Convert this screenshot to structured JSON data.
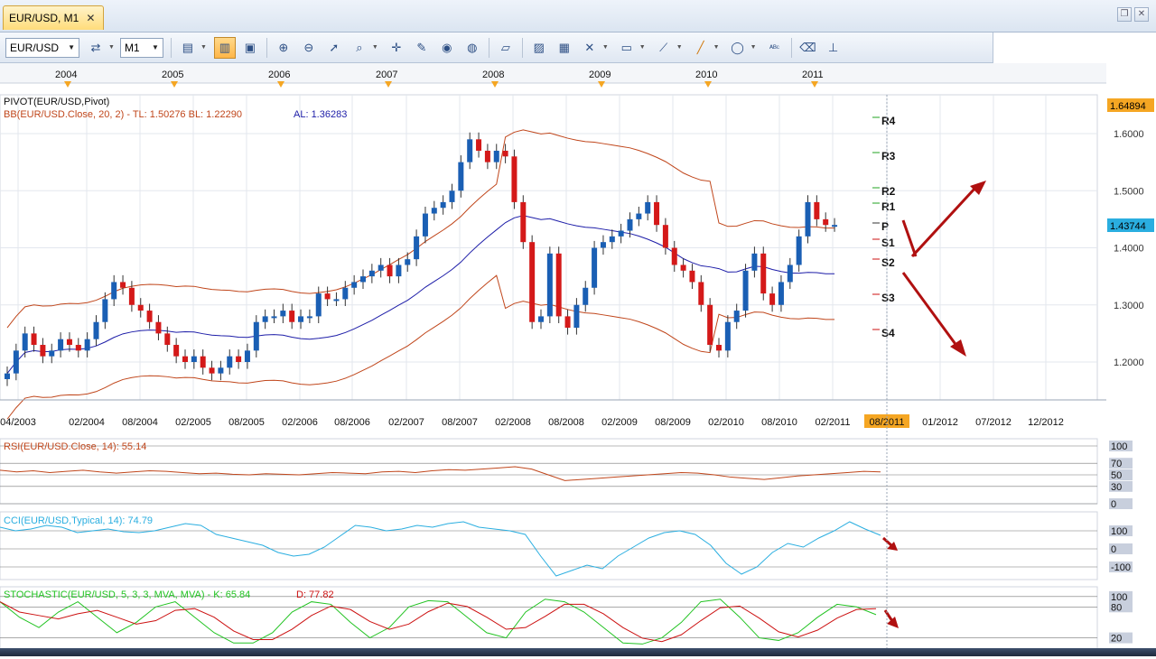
{
  "tab": {
    "title": "EUR/USD, M1",
    "close": "✕"
  },
  "window_buttons": [
    "❐",
    "✕"
  ],
  "toolbar": {
    "symbol": "EUR/USD",
    "timeframe": "M1",
    "icons": [
      "order-icon",
      "chart-type-icon",
      "candles-icon",
      "ohlc-icon",
      "zoom-in-icon",
      "zoom-out-icon",
      "cursor-icon",
      "magnifier-icon",
      "crosshair-icon",
      "pencil-icon",
      "eye-icon",
      "globe-icon",
      "ruler-icon",
      "image-icon",
      "template-icon",
      "tools-icon",
      "indicator-icon",
      "trendline-icon",
      "line-color-icon",
      "ellipse-icon",
      "text-icon",
      "eraser-icon",
      "hierarchy-icon"
    ]
  },
  "main": {
    "year_labels": [
      "2004",
      "2005",
      "2006",
      "2007",
      "2008",
      "2009",
      "2010",
      "2011"
    ],
    "legend": {
      "pivot": "PIVOT(EUR/USD,Pivot)",
      "bb": "BB(EUR/USD.Close, 20, 2) -  TL: 1.50276  BL: 1.22290",
      "al": "AL: 1.36283"
    },
    "y_ticks": [
      "1.6000",
      "1.5000",
      "1.4000",
      "1.3000",
      "1.2000"
    ],
    "price_top": "1.64894",
    "price_last": "1.43744",
    "pivot_labels": [
      "R4",
      "R3",
      "R2",
      "R1",
      "P",
      "S1",
      "S2",
      "S3",
      "S4"
    ],
    "x_ticks": [
      "04/2003",
      "02/2004",
      "08/2004",
      "02/2005",
      "08/2005",
      "02/2006",
      "08/2006",
      "02/2007",
      "08/2007",
      "02/2008",
      "08/2008",
      "02/2009",
      "08/2009",
      "02/2010",
      "08/2010",
      "02/2011",
      "08/2011",
      "01/2012",
      "07/2012",
      "12/2012"
    ],
    "x_highlight": "08/2011"
  },
  "rsi": {
    "legend": "RSI(EUR/USD.Close, 14): 55.14",
    "ticks": [
      "100",
      "70",
      "50",
      "30",
      "0"
    ]
  },
  "cci": {
    "legend": "CCI(EUR/USD,Typical, 14): 74.79",
    "ticks": [
      "100",
      "0",
      "-100"
    ]
  },
  "stoch": {
    "legend_main": "STOCHASTIC(EUR/USD, 5, 3, 3, MVA, MVA) -  K: 65.84",
    "legend_d": "D: 77.82",
    "ticks": [
      "100",
      "80",
      "20"
    ]
  },
  "colors": {
    "up": "#1a5fb4",
    "down": "#d41919",
    "bb": "#c0461b",
    "ma": "#1d1da8",
    "rsi": "#c0461b",
    "cci": "#2aaee0",
    "k": "#22c322",
    "d": "#cc1111",
    "arrow": "#b01010",
    "highlight": "#f5a623"
  }
}
